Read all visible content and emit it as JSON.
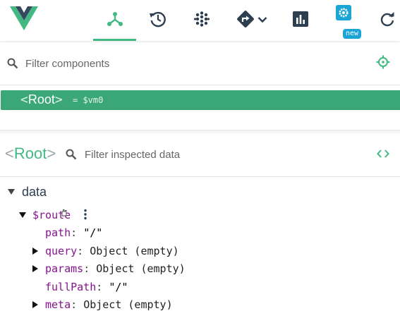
{
  "toolbar": {
    "tabs": [
      {
        "icon": "components-icon",
        "active": true
      },
      {
        "icon": "history-icon"
      },
      {
        "icon": "vuex-icon"
      },
      {
        "icon": "routing-icon"
      },
      {
        "icon": "performance-icon"
      },
      {
        "icon": "settings-icon"
      },
      {
        "icon": "refresh-icon"
      }
    ],
    "new_badge": "new",
    "colors": {
      "accent": "#42b983",
      "badge": "#1ba5d6"
    }
  },
  "components_filter": {
    "placeholder": "Filter components"
  },
  "tree": {
    "root": {
      "open": "<",
      "name": "Root",
      "close": ">",
      "vm_label": "= $vm0"
    }
  },
  "inspector": {
    "open": "<",
    "name": "Root",
    "close": ">",
    "filter_placeholder": "Filter inspected data",
    "section": "data",
    "route": {
      "key": "$route",
      "fields": [
        {
          "key": "path",
          "colon": ":",
          "value": "\"/\"",
          "expandable": false
        },
        {
          "key": "query",
          "colon": ":",
          "value": "Object (empty)",
          "expandable": true
        },
        {
          "key": "params",
          "colon": ":",
          "value": "Object (empty)",
          "expandable": true
        },
        {
          "key": "fullPath",
          "colon": ":",
          "value": "\"/\"",
          "expandable": false
        },
        {
          "key": "meta",
          "colon": ":",
          "value": "Object (empty)",
          "expandable": true
        }
      ]
    }
  }
}
